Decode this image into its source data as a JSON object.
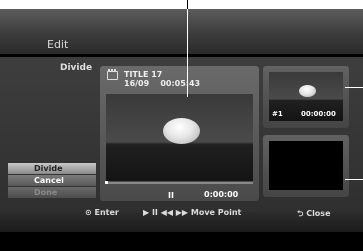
{
  "header": {
    "title": "Edit"
  },
  "left_panel": {
    "label": "Divide"
  },
  "menu": [
    {
      "label": "Divide",
      "state": "selected"
    },
    {
      "label": "Cancel",
      "state": "normal"
    },
    {
      "label": "Done",
      "state": "disabled"
    }
  ],
  "main_preview": {
    "icon": "clip-icon",
    "title_line": "TITLE 17",
    "date_line": "16/09    00:05:43",
    "transport_symbol": "II",
    "time": "0:00:00"
  },
  "thumbnails": [
    {
      "number": "#1",
      "time": "00:00:00"
    }
  ],
  "footer": {
    "enter": "⊙ Enter",
    "move_point": "▶ II ◀◀ ▶▶ Move Point",
    "close": "⮌ Close"
  }
}
